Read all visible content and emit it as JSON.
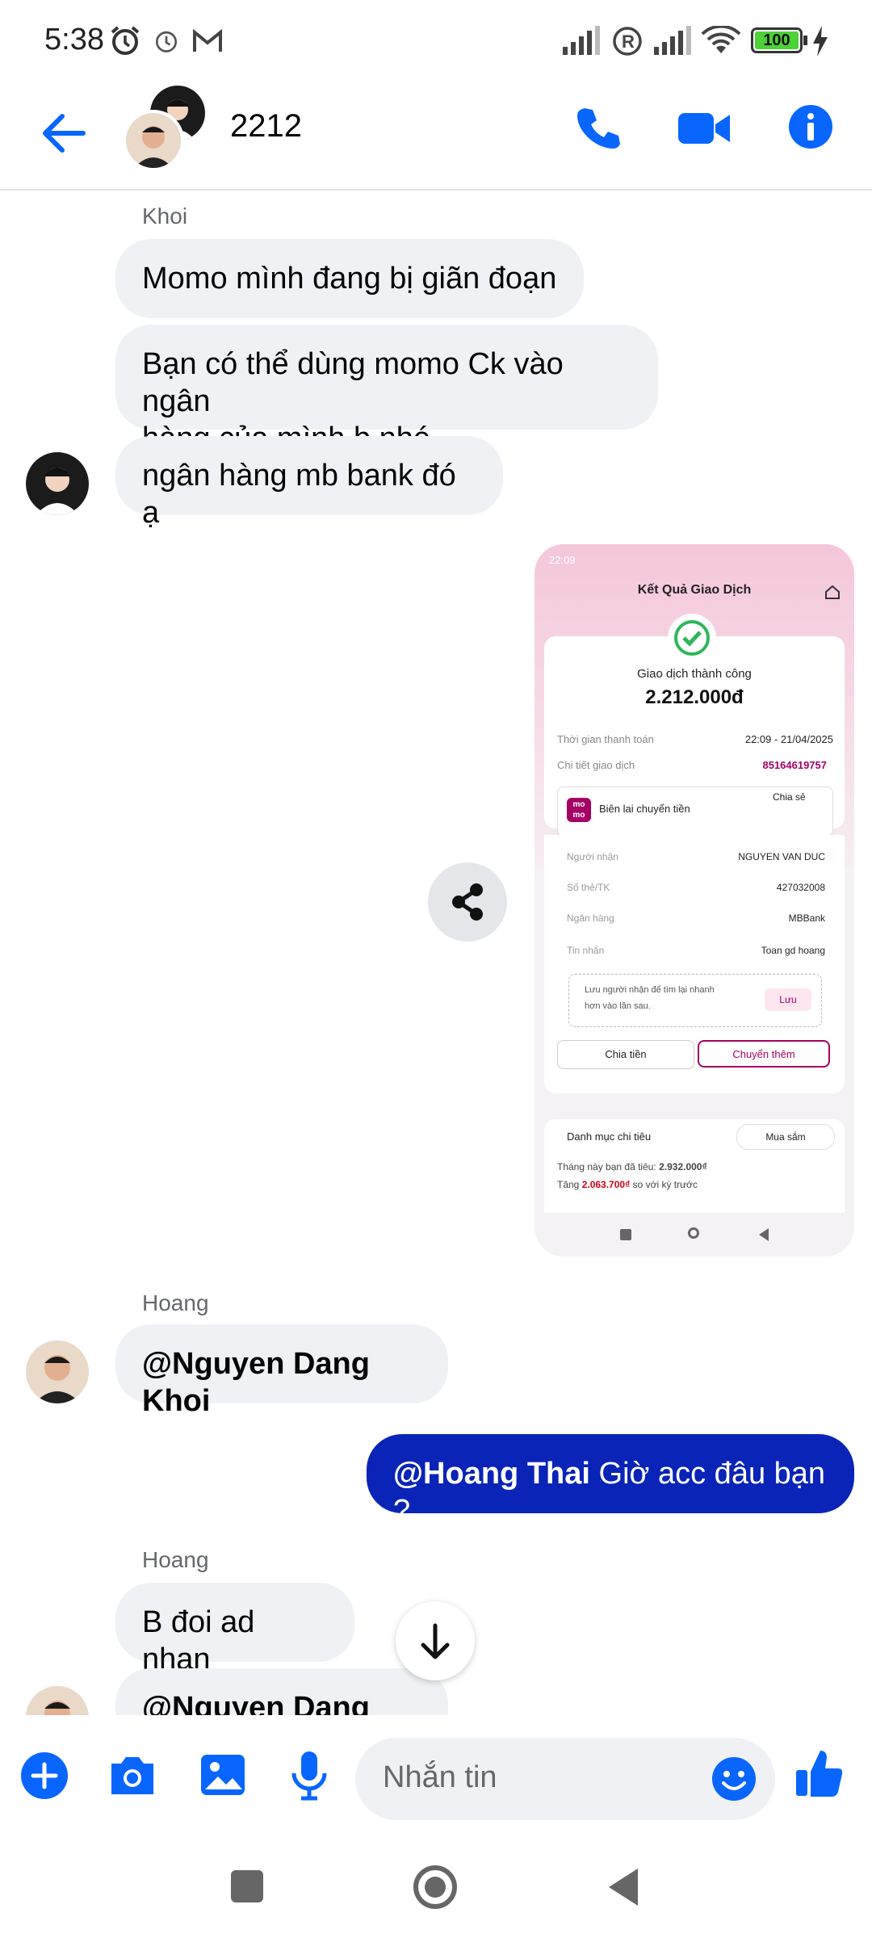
{
  "status_bar": {
    "time": "5:38",
    "battery": "100"
  },
  "header": {
    "title": "2212"
  },
  "messages": {
    "khoi_name": "Khoi",
    "m1": "Momo mình đang bị giãn đoạn",
    "m2_line1": "Bạn có thể dùng momo Ck vào ngân",
    "m2_line2": "hàng của mình b nhé",
    "m3": "ngân hàng mb bank đó ạ",
    "hoang_name": "Hoang",
    "m4_mention": "@Nguyen Dang Khoi",
    "m5_mention": "@Hoang Thai",
    "m5_text": " Giờ acc đâu bạn ?",
    "hoang_name2": "Hoang",
    "m6": "B đoi ad nhan",
    "m7_mention": "@Nguyen Dang Khoi"
  },
  "receipt": {
    "status_time": "22:09",
    "title": "Kết Quả Giao Dịch",
    "success": "Giao dịch thành công",
    "amount": "2.212.000đ",
    "time_label": "Thời gian thanh toán",
    "time_value": "22:09 - 21/04/2025",
    "detail_label": "Chi tiết giao dịch",
    "detail_value": "85164619757",
    "receipt_label": "Biên lai chuyển tiền",
    "share_label": "Chia sẻ",
    "recipient_label": "Người nhận",
    "recipient_value": "NGUYEN VAN DUC",
    "account_label": "Số thẻ/TK",
    "account_value": "427032008",
    "bank_label": "Ngân hàng",
    "bank_value": "MBBank",
    "message_label": "Tin nhắn",
    "message_value": "Toan gd hoang",
    "save_hint_line1": "Lưu người nhận để tìm lại nhanh",
    "save_hint_line2": "hơn vào lần sau.",
    "save_btn": "Lưu",
    "split_btn": "Chia tiền",
    "more_btn": "Chuyển thêm",
    "category_label": "Danh mục chi tiêu",
    "category_value": "Mua sắm",
    "spent_prefix": "Tháng này bạn đã tiêu: ",
    "spent_value": "2.932.000₫",
    "increase_prefix": "Tăng ",
    "increase_value": "2.063.700₫",
    "increase_suffix": " so với kỳ trước"
  },
  "composer": {
    "placeholder": "Nhắn tin"
  },
  "colors": {
    "accent": "#0866ff",
    "outgoing": "#0a24b8",
    "momo": "#a50064"
  }
}
